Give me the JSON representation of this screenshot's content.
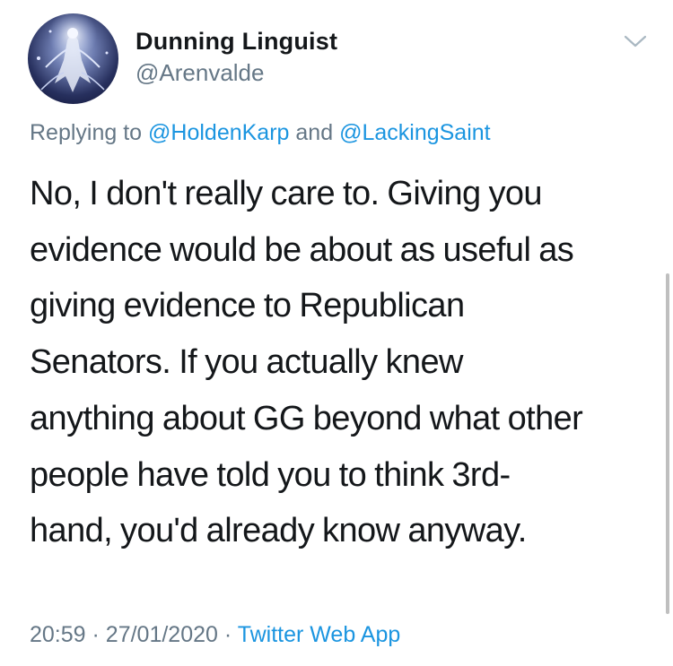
{
  "author": {
    "display_name": "Dunning Linguist",
    "handle": "@Arenvalde"
  },
  "reply": {
    "prefix": "Replying to",
    "mention1": "@HoldenKarp",
    "joiner": "and",
    "mention2": "@LackingSaint"
  },
  "tweet": {
    "lines": [
      "No, I don't really care to. Giving you",
      "evidence would be about as useful as",
      "giving evidence to Republican",
      "Senators. If you actually knew",
      "anything about GG beyond what other",
      "people have told you to think 3rd-",
      "hand, you'd already know anyway."
    ]
  },
  "meta": {
    "time": "20:59",
    "separator": "·",
    "date": "27/01/2020",
    "source": "Twitter Web App"
  },
  "icons": {
    "avatar": "profile-picture",
    "caret": "chevron-down-icon"
  },
  "colors": {
    "text": "#14171a",
    "secondary": "#657786",
    "link": "#1b95e0"
  }
}
